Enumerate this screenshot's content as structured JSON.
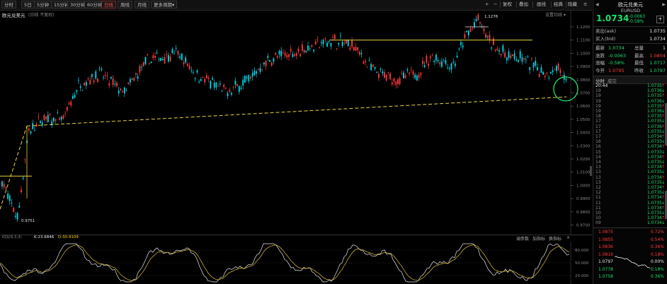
{
  "toolbar": {
    "periods": [
      "分时",
      "5日",
      "5分钟",
      "15分钟",
      "30分钟",
      "60分钟",
      "日线",
      "周线",
      "月线",
      "更多周期"
    ],
    "active_period": "日线",
    "more_suffix": "▾",
    "plus": "+",
    "minus": "−",
    "buttons": [
      "复权",
      "叠加",
      "画线",
      "经典",
      "隐藏"
    ],
    "more_icon": "≡"
  },
  "chart": {
    "title": "欧元兑美元",
    "subtitle": "(日线 不复权)",
    "settings": "设置均线",
    "high_label": "1.1276",
    "low_label": "0.9751"
  },
  "y_axis_labels": [
    "1.1200",
    "1.1100",
    "1.1000",
    "1.0900",
    "1.0800",
    "1.0700",
    "1.0600",
    "1.0500",
    "1.0400",
    "1.0300",
    "1.0200",
    "1.0100",
    "1.0000",
    "0.9900",
    "0.9800",
    "0.9700"
  ],
  "osc_axis_labels": [
    "80.000",
    "50.000",
    "20.000"
  ],
  "indicator": {
    "name": "KDJ(9,3,3)",
    "k_label": "K:23.6846",
    "d_label": "D:30.9109",
    "params": "调参数",
    "add": "加指标",
    "switch": "换指标",
    "close": "×"
  },
  "quote": {
    "name": "欧元兑美元",
    "code": "EURUSD",
    "price": "1.0734",
    "change": "-0.0063",
    "change_pct": "-0.58%",
    "ask_label": "卖出(ask)",
    "ask": "1.0735",
    "bid_label": "买入(bid)",
    "bid": "1.0734",
    "rows": [
      {
        "l": "最新",
        "v1": "1.0734",
        "m": "总量",
        "v2": "1"
      },
      {
        "l": "涨跌",
        "v1": "-0.0063",
        "m": "最高",
        "v2": "1.0804"
      },
      {
        "l": "涨幅",
        "v1": "-0.58%",
        "m": "最低",
        "v2": "1.0717"
      },
      {
        "l": "今开",
        "v1": "1.0795",
        "m": "昨收",
        "v2": "1.0797"
      }
    ],
    "tabs": [
      "分时",
      "成交"
    ]
  },
  "ticks": [
    {
      "t": "20:44",
      "p": "1.0735"
    },
    {
      "t": "19",
      "p": "1.0736"
    },
    {
      "t": "19",
      "p": "1.0735"
    },
    {
      "t": "19",
      "p": "1.0736"
    },
    {
      "t": "19",
      "p": "1.0735"
    },
    {
      "t": "19",
      "p": "1.0736"
    },
    {
      "t": "18",
      "p": "1.0735"
    },
    {
      "t": "17",
      "p": "1.0735"
    },
    {
      "t": "17",
      "p": "1.0736"
    },
    {
      "t": "17",
      "p": "1.0735"
    },
    {
      "t": "17",
      "p": "1.0734"
    },
    {
      "t": "16",
      "p": "1.0733"
    },
    {
      "t": "16",
      "p": "1.0734"
    },
    {
      "t": "15",
      "p": "1.0733"
    },
    {
      "t": "14",
      "p": "1.0734"
    },
    {
      "t": "14",
      "p": "1.0735"
    },
    {
      "t": "13",
      "p": "1.0734"
    },
    {
      "t": "13",
      "p": "1.0735"
    },
    {
      "t": "13",
      "p": "1.0734"
    },
    {
      "t": "13",
      "p": "1.0735"
    },
    {
      "t": "12",
      "p": "1.0734"
    },
    {
      "t": "12",
      "p": "1.0735"
    },
    {
      "t": "11",
      "p": "1.0734"
    },
    {
      "t": "11",
      "p": "1.0735"
    },
    {
      "t": "11",
      "p": "1.0734"
    },
    {
      "t": "10",
      "p": "1.0735"
    },
    {
      "t": "10",
      "p": "1.0734"
    },
    {
      "t": "09",
      "p": "1.0734"
    }
  ],
  "mini_levels": [
    {
      "p": "1.0875",
      "c": "0.72%"
    },
    {
      "p": "1.0855",
      "c": "0.54%"
    },
    {
      "p": "1.0836",
      "c": "0.36%"
    },
    {
      "p": "1.0816",
      "c": "0.18%"
    },
    {
      "p": "1.0797",
      "c": "0.00%"
    },
    {
      "p": "1.0778",
      "c": "0.18%"
    },
    {
      "p": "1.0758",
      "c": "0.36%"
    }
  ],
  "colors": {
    "up": "#ff3b3b",
    "down": "#00d8e8",
    "support": "#e8d53a",
    "highlight": "#19e06b"
  }
}
